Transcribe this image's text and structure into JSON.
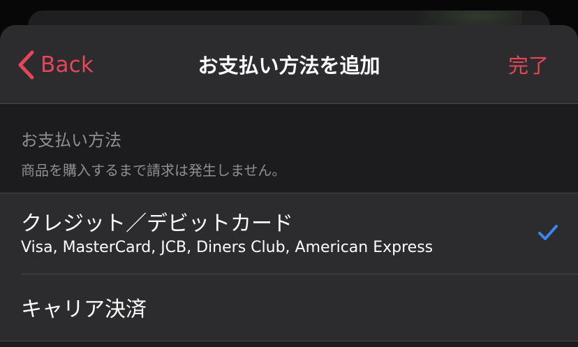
{
  "colors": {
    "accent": "#e5475a",
    "check": "#3a86f0",
    "sheet_bg": "#2c2c2e",
    "section_bg": "#1c1c1e"
  },
  "nav": {
    "back_icon": "chevron-left-icon",
    "back_label": "Back",
    "title": "お支払い方法を追加",
    "done_label": "完了"
  },
  "section": {
    "title": "お支払い方法",
    "subtitle": "商品を購入するまで請求は発生しません。"
  },
  "payment_options": [
    {
      "title": "クレジット／デビットカード",
      "subtitle": "Visa, MasterCard, JCB, Diners Club, American Express",
      "selected": true,
      "icon": "checkmark-icon"
    },
    {
      "title": "キャリア決済",
      "subtitle": "",
      "selected": false
    }
  ]
}
